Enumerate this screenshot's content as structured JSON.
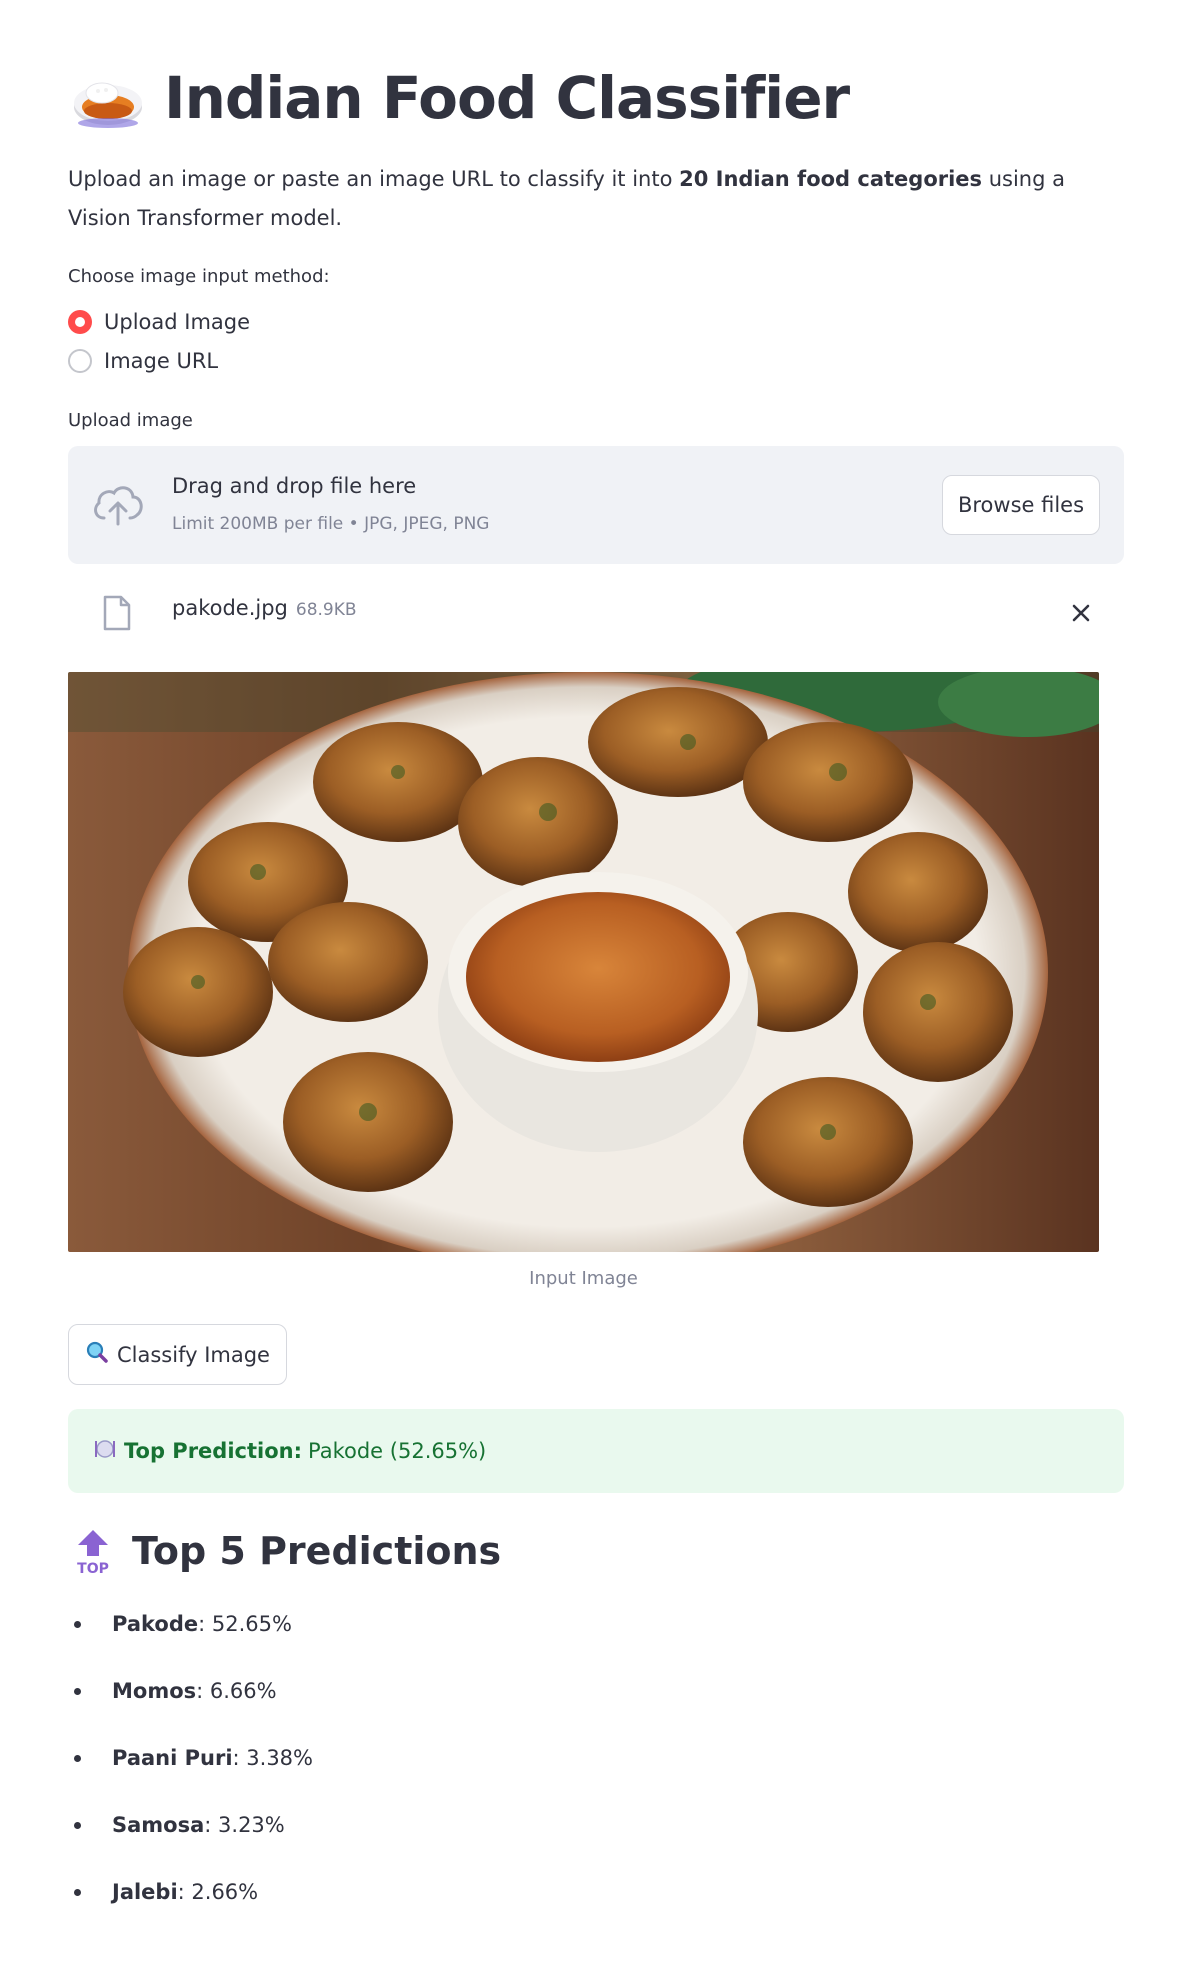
{
  "header": {
    "title": "Indian Food Classifier",
    "emoji": "curry-rice-icon"
  },
  "intro": {
    "part1": "Upload an image or paste an image URL to classify it into ",
    "bold": "20 Indian food categories",
    "part2": " using a Vision Transformer model."
  },
  "input_method": {
    "label": "Choose image input method:",
    "options": [
      "Upload Image",
      "Image URL"
    ],
    "selected": "Upload Image"
  },
  "uploader": {
    "label": "Upload image",
    "drop_text": "Drag and drop file here",
    "limit_text": "Limit 200MB per file • JPG, JPEG, PNG",
    "browse_label": "Browse files"
  },
  "uploaded_file": {
    "name": "pakode.jpg",
    "size": "68.9KB"
  },
  "image": {
    "caption": "Input Image"
  },
  "classify_button": {
    "label": "Classify Image",
    "icon": "magnifier-icon"
  },
  "result": {
    "icon": "plate-cutlery-icon",
    "label": "Top Prediction:",
    "value": "Pakode (52.65%)"
  },
  "predictions": {
    "title": "Top 5 Predictions",
    "icon": "top-arrow-icon",
    "items": [
      {
        "name": "Pakode",
        "value": ": 52.65%"
      },
      {
        "name": "Momos",
        "value": ": 6.66%"
      },
      {
        "name": "Paani Puri",
        "value": ": 3.38%"
      },
      {
        "name": "Samosa",
        "value": ": 3.23%"
      },
      {
        "name": "Jalebi",
        "value": ": 2.66%"
      }
    ]
  },
  "colors": {
    "accent": "#ff4b4b",
    "success_bg": "#e9f9ee",
    "success_text": "#177233",
    "text": "#31333f",
    "muted": "#808495"
  }
}
